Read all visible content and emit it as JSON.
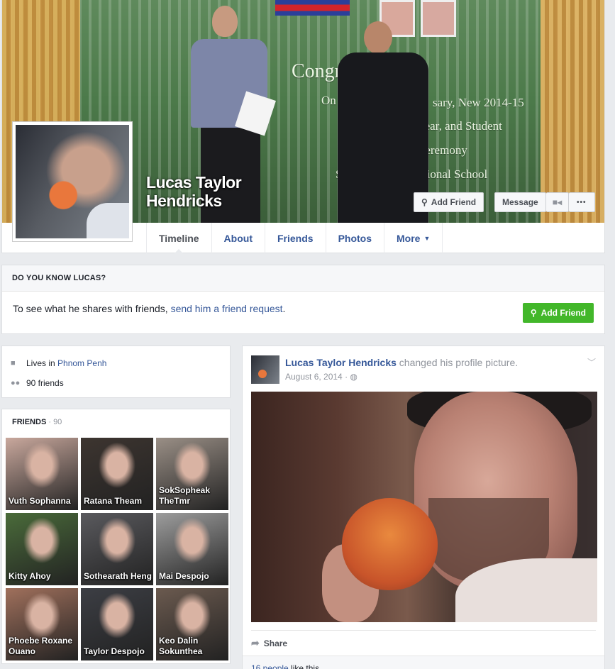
{
  "profile": {
    "name_line1": "Lucas Taylor",
    "name_line2": "Hendricks"
  },
  "cover": {
    "banner": [
      "Congratulati",
      "On",
      "sary, New 2014-15",
      "Year, and Student",
      "Ceremony",
      "Su",
      "ternational School"
    ]
  },
  "cover_buttons": {
    "add_friend": "Add Friend",
    "message": "Message",
    "add_friend_icon": "person-plus-icon",
    "video_icon": "video-camera-icon",
    "more_icon": "ellipsis-icon",
    "more_glyph": "•••"
  },
  "tabs": [
    {
      "label": "Timeline"
    },
    {
      "label": "About"
    },
    {
      "label": "Friends"
    },
    {
      "label": "Photos"
    },
    {
      "label": "More"
    }
  ],
  "know": {
    "heading": "DO YOU KNOW LUCAS?",
    "text_prefix": "To see what he shares with friends, ",
    "link": "send him a friend request",
    "text_suffix": ".",
    "button": "Add Friend"
  },
  "intro": {
    "lives_prefix": "Lives in ",
    "lives_city": "Phnom Penh",
    "friends_count": "90 friends"
  },
  "friends": {
    "heading": "FRIENDS",
    "count": "90",
    "list": [
      {
        "name": "Vuth Sophanna",
        "color": "#c9a89d"
      },
      {
        "name": "Ratana Theam",
        "color": "#3d3530"
      },
      {
        "name": "SokSopheak TheTmr",
        "color": "#9a8f86"
      },
      {
        "name": "Kitty Ahoy",
        "color": "#4a6b3a"
      },
      {
        "name": "Sothearath Heng",
        "color": "#5a5a5e"
      },
      {
        "name": "Mai Despojo",
        "color": "#9d9d9d"
      },
      {
        "name": "Phoebe Roxane Ouano",
        "color": "#a0705c"
      },
      {
        "name": "Taylor Despojo",
        "color": "#3c3e44"
      },
      {
        "name": "Keo Dalin Sokunthea",
        "color": "#6b5a4f"
      }
    ]
  },
  "post": {
    "author": "Lucas Taylor Hendricks",
    "action": " changed his profile picture.",
    "date": "August 6, 2014 · ",
    "globe_icon": "globe-icon",
    "share": "Share",
    "likes_link": "16 people",
    "likes_suffix": " like this."
  },
  "colors": {
    "link_blue": "#365899",
    "green_button": "#42b72a",
    "page_bg": "#e9ebee"
  }
}
